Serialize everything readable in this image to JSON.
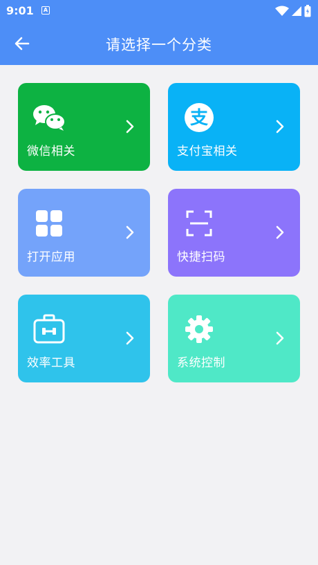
{
  "status": {
    "time": "9:01",
    "notification_glyph": "A"
  },
  "header": {
    "title": "请选择一个分类",
    "back_icon": "arrow-left-icon"
  },
  "categories": [
    {
      "label": "微信相关",
      "icon": "wechat-icon",
      "color": "#0db242"
    },
    {
      "label": "支付宝相关",
      "icon": "alipay-icon",
      "color": "#09b2f6"
    },
    {
      "label": "打开应用",
      "icon": "apps-grid-icon",
      "color": "#74a3fa"
    },
    {
      "label": "快捷扫码",
      "icon": "scan-icon",
      "color": "#8c74fb"
    },
    {
      "label": "效率工具",
      "icon": "toolbox-icon",
      "color": "#2fc3eb"
    },
    {
      "label": "系统控制",
      "icon": "gear-icon",
      "color": "#4fe8c7"
    }
  ],
  "colors": {
    "primary": "#4d8ef7",
    "background": "#f2f2f4"
  }
}
